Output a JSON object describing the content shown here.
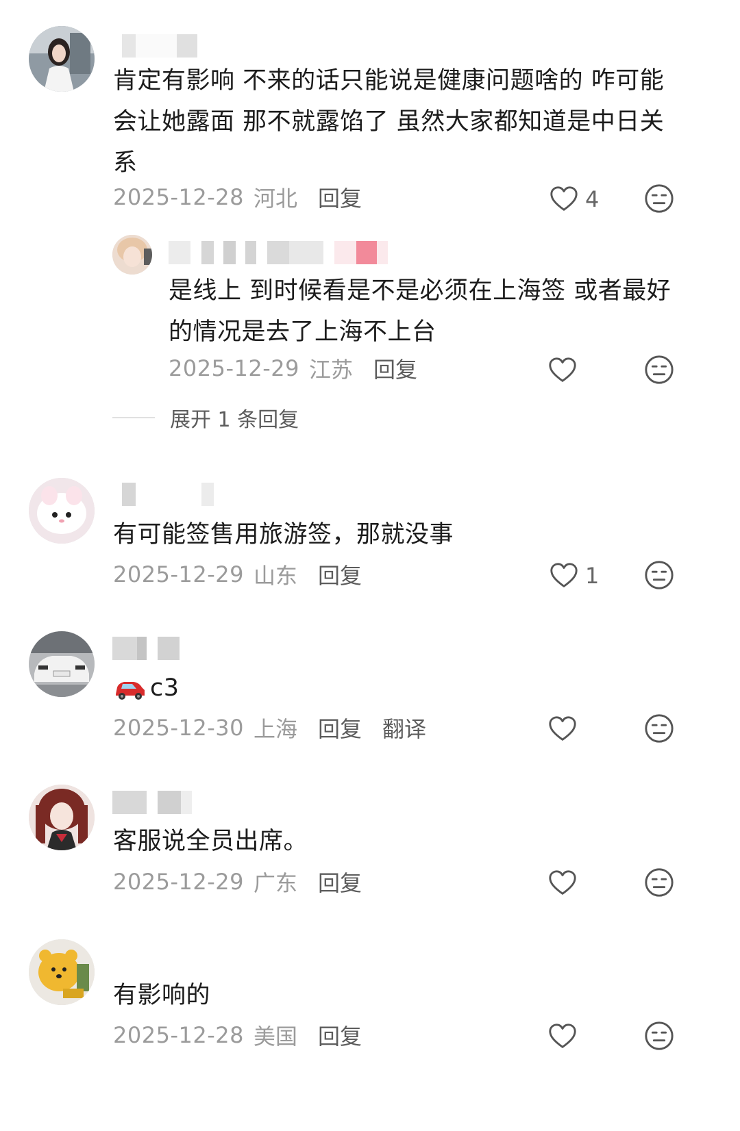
{
  "colors": {
    "text": "#1c1c1c",
    "meta": "#9b9b9b",
    "action": "#5c5c5c",
    "icon": "#555555"
  },
  "icons": {
    "like": "heart-outline-icon",
    "dislike": "neutral-face-icon",
    "car": "red-car-emoji"
  },
  "comments": [
    {
      "text": "肯定有影响 不来的话只能说是健康问题啥的 咋可能会让她露面 那不就露馅了 虽然大家都知道是中日关系",
      "date": "2025-12-28",
      "location": "河北",
      "reply_label": "回复",
      "likes": "4",
      "reply": {
        "text": "是线上 到时候看是不是必须在上海签 或者最好的情况是去了上海不上台",
        "date": "2025-12-29",
        "location": "江苏",
        "reply_label": "回复"
      },
      "expand_label": "展开 1 条回复"
    },
    {
      "text": "有可能签售用旅游签，那就没事",
      "date": "2025-12-29",
      "location": "山东",
      "reply_label": "回复",
      "likes": "1"
    },
    {
      "text": "c3",
      "date": "2025-12-30",
      "location": "上海",
      "reply_label": "回复",
      "translate_label": "翻译"
    },
    {
      "text": "客服说全员出席。",
      "date": "2025-12-29",
      "location": "广东",
      "reply_label": "回复"
    },
    {
      "text": "有影响的",
      "date": "2025-12-28",
      "location": "美国",
      "reply_label": "回复"
    }
  ]
}
